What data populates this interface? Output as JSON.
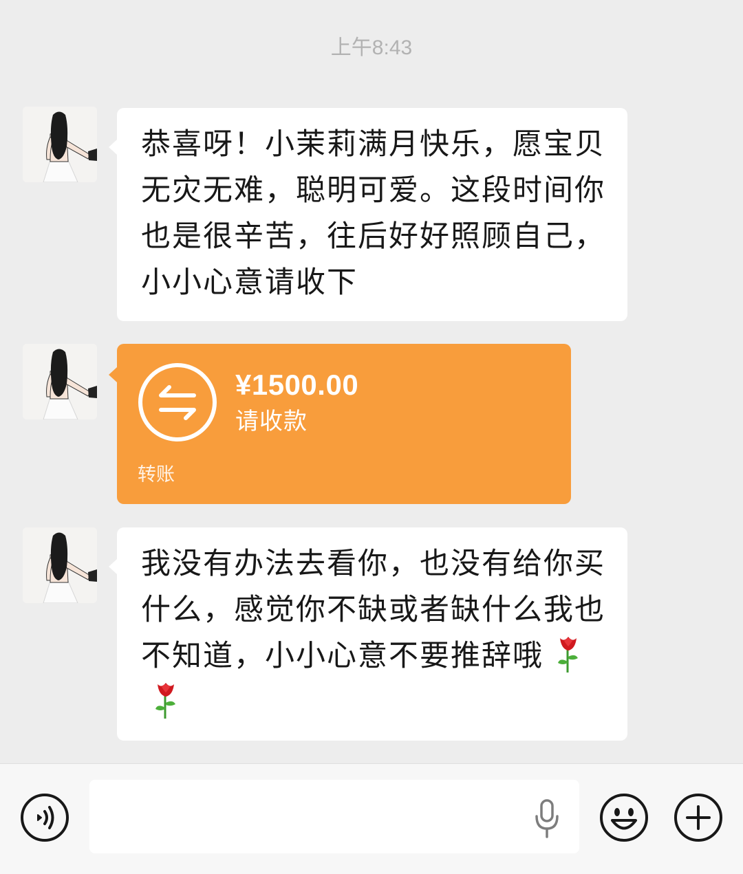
{
  "chat": {
    "timestamp": "上午8:43",
    "messages": [
      {
        "type": "text",
        "sender": "contact",
        "avatar_icon": "girl-avatar-icon",
        "text": "恭喜呀！小茉莉满月快乐，愿宝贝无灾无难，聪明可爱。这段时间你也是很辛苦，往后好好照顾自己，小小心意请收下"
      },
      {
        "type": "transfer",
        "sender": "contact",
        "avatar_icon": "girl-avatar-icon",
        "icon": "transfer-arrows-icon",
        "amount": "¥1500.00",
        "status": "请收款",
        "label": "转账"
      },
      {
        "type": "text",
        "sender": "contact",
        "avatar_icon": "girl-avatar-icon",
        "text": "我没有办法去看你，也没有给你买什么，感觉你不缺或者缺什么我也不知道，小小心意不要推辞哦",
        "emojis": [
          "rose-icon",
          "rose-icon"
        ]
      }
    ]
  },
  "input_bar": {
    "voice_icon": "voice-icon",
    "text": "",
    "mic_icon": "microphone-icon",
    "emoji_icon": "smiley-icon",
    "more_icon": "plus-icon"
  },
  "colors": {
    "background": "#ededed",
    "bubble": "#ffffff",
    "transfer": "#f89d3c",
    "timestamp": "#b2b2b2",
    "text": "#181818"
  }
}
